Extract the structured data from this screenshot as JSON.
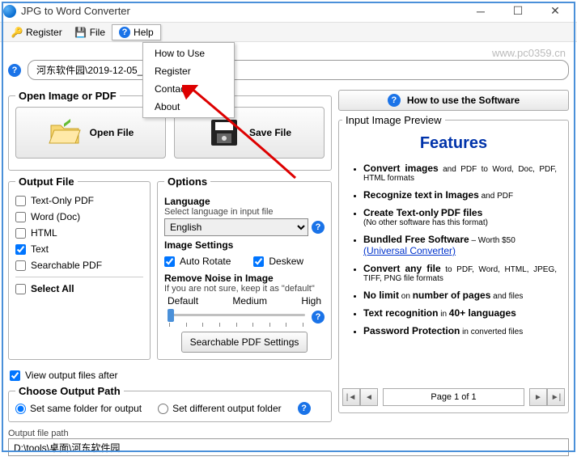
{
  "window": {
    "title": "JPG to Word Converter",
    "watermark": "www.pc0359.cn"
  },
  "menubar": {
    "register": "Register",
    "file": "File",
    "help": "Help",
    "dropdown": {
      "howto": "How to Use",
      "register": "Register",
      "contact": "Contact",
      "about": "About"
    }
  },
  "filepath": "河东软件园\\2019-12-05_140227.png",
  "open_pdf_legend": "Open Image or PDF",
  "buttons": {
    "open_file": "Open File",
    "save_file": "Save File"
  },
  "output_file": {
    "legend": "Output File",
    "text_only_pdf": "Text-Only PDF",
    "word_doc": "Word (Doc)",
    "html": "HTML",
    "text": "Text",
    "searchable_pdf": "Searchable PDF",
    "select_all": "Select All"
  },
  "options": {
    "legend": "Options",
    "language_label": "Language",
    "language_desc": "Select language in input file",
    "language_value": "English",
    "image_settings": "Image Settings",
    "auto_rotate": "Auto Rotate",
    "deskew": "Deskew",
    "remove_noise": "Remove Noise in Image",
    "remove_noise_hint": "If you are not sure, keep it as \"default\"",
    "slider_default": "Default",
    "slider_medium": "Medium",
    "slider_high": "High",
    "searchable_pdf_btn": "Searchable PDF Settings"
  },
  "view_output": "View output files after",
  "choose_output": {
    "legend": "Choose Output Path",
    "same": "Set same folder for output",
    "diff": "Set different output folder"
  },
  "output_path": {
    "label": "Output file path",
    "value": "D:\\tools\\桌面\\河东软件园"
  },
  "right": {
    "howto_header": "How to use the Software",
    "preview_legend": "Input Image Preview",
    "features_title": "Features",
    "features": [
      "Convert images and PDF to Word, Doc, PDF, HTML formats",
      "Recognize text in Images and PDF",
      "Create Text-only PDF files<br>(No other software has this format)",
      "Bundled Free Software – Worth $50<br><a href='#'>(Universal Converter)</a>",
      "Convert any file to PDF, Word, HTML, JPEG, TIFF, PNG file formats",
      "No limit on number of pages and files",
      "Text recognition in 40+ languages",
      "Password Protection in converted files"
    ],
    "pager": "Page 1 of 1"
  }
}
